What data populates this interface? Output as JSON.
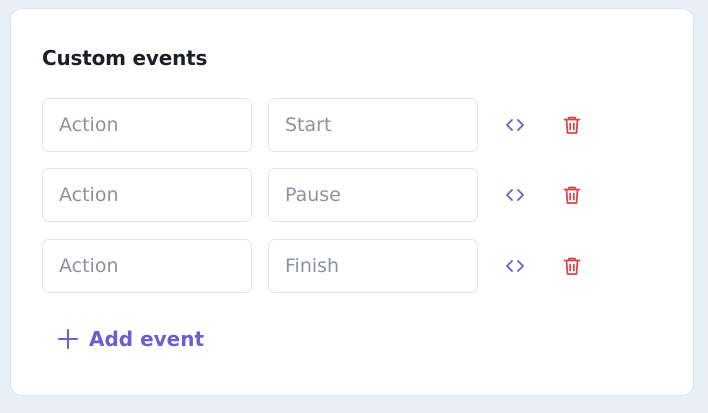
{
  "card": {
    "title": "Custom events"
  },
  "events": [
    {
      "key_placeholder": "Action",
      "value": "Start"
    },
    {
      "key_placeholder": "Action",
      "value": "Pause"
    },
    {
      "key_placeholder": "Action",
      "value": "Finish"
    }
  ],
  "add_button": {
    "label": "Add event",
    "icon": "plus-icon"
  },
  "row_icons": {
    "code": "code-icon",
    "delete": "trash-icon"
  },
  "colors": {
    "accent": "#6a5fcf",
    "danger": "#d9474a",
    "title": "#1b1f27",
    "placeholder": "#8d939b",
    "border": "#e1e6ec"
  }
}
